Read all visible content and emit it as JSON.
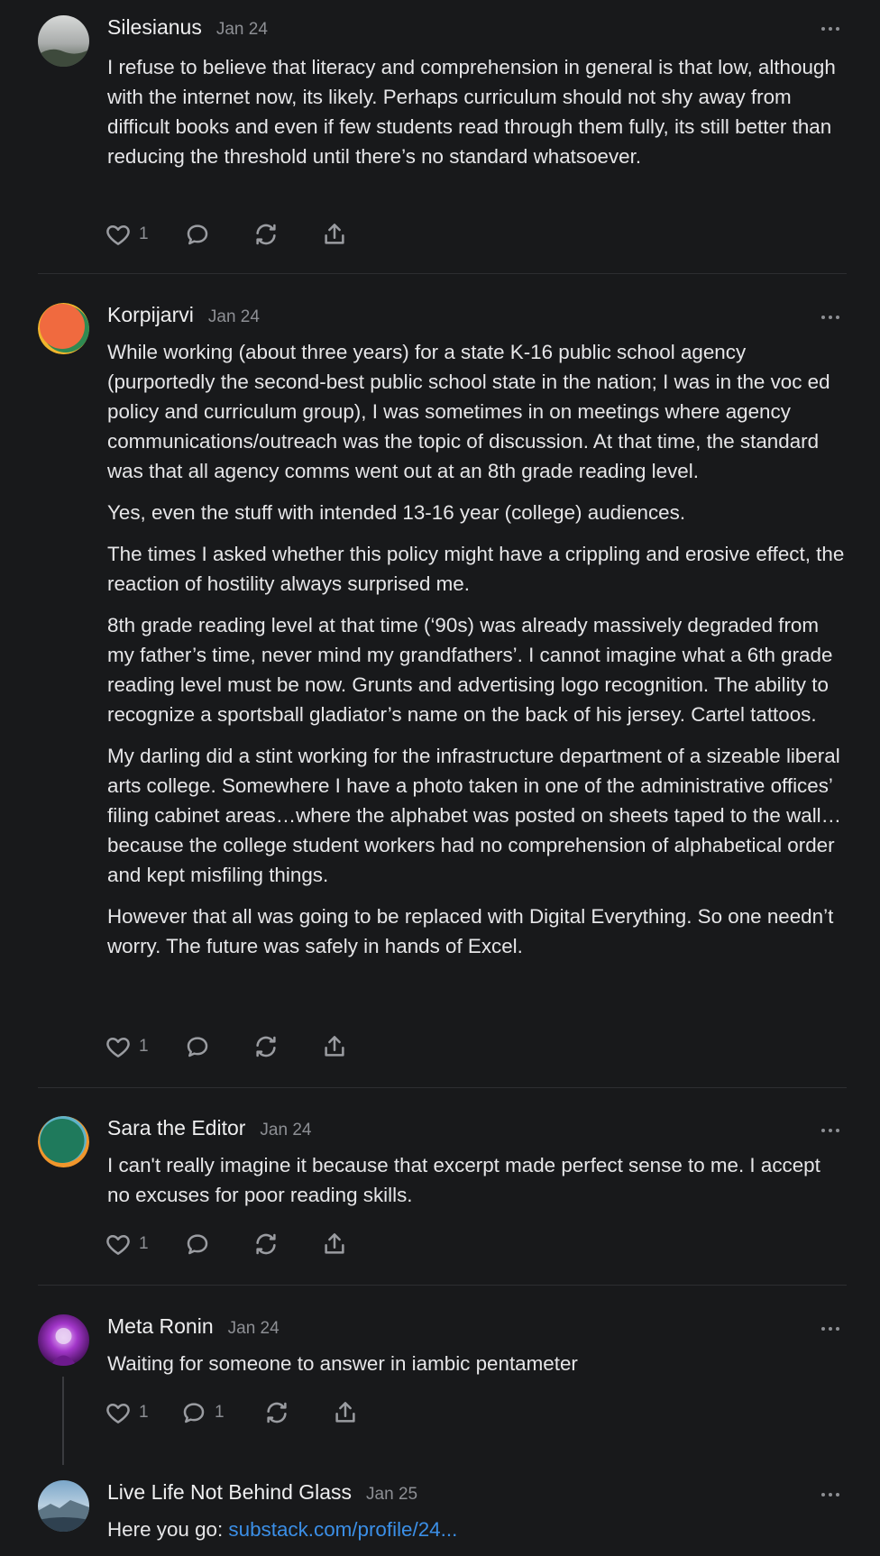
{
  "comments": [
    {
      "author": "Silesianus",
      "date": "Jan 24",
      "paragraphs": [
        "I refuse to believe that literacy and comprehension in general is that low, although with the internet now, its likely. Perhaps curriculum should not shy away from difficult books and even if few students read through them fully, its still better than reducing the threshold until there’s no standard whatsoever."
      ],
      "likes": "1"
    },
    {
      "author": "Korpijarvi",
      "date": "Jan 24",
      "paragraphs": [
        "While working (about three years) for a state K-16 public school agency (purportedly the second-best public school state in the nation; I was in the voc ed policy and curriculum group), I was sometimes in on meetings where agency communications/outreach was the topic of discussion. At that time, the standard was that all agency comms went out at an 8th grade reading level.",
        "Yes, even the stuff with intended 13-16 year (college) audiences.",
        "The times I asked whether this policy might have a crippling and erosive effect, the reaction of hostility always surprised me.",
        "8th grade reading level at that time (‘90s) was already massively degraded from my father’s time, never mind my grandfathers’. I cannot imagine what a 6th grade reading level must be now. Grunts and advertising logo recognition. The ability to recognize a sportsball gladiator’s name on the back of his jersey. Cartel tattoos.",
        "My darling did a stint working for the infrastructure department of a sizeable liberal arts college. Somewhere I have a photo taken in one of the administrative offices’ filing cabinet areas…where the alphabet was posted on sheets taped to the wall…because the college student workers had no comprehension of alphabetical order and kept misfiling things.",
        "However that all was going to be replaced with Digital Everything. So one needn’t worry. The future was safely in hands of Excel."
      ],
      "likes": "1"
    },
    {
      "author": "Sara the Editor",
      "date": "Jan 24",
      "paragraphs": [
        "I can't really imagine it because that excerpt made perfect sense to me. I accept no excuses for poor reading skills."
      ],
      "likes": "1"
    },
    {
      "author": "Meta Ronin",
      "date": "Jan 24",
      "paragraphs": [
        "Waiting for someone to answer in iambic pentameter"
      ],
      "likes": "1",
      "replies": "1"
    },
    {
      "author": "Live Life Not Behind Glass",
      "date": "Jan 25",
      "prefix": "Here you go: ",
      "link": "substack.com/profile/24..."
    }
  ],
  "icons": [
    "heart-icon",
    "comment-icon",
    "restack-icon",
    "share-icon",
    "more-icon"
  ],
  "colors": {
    "background": "#18191b",
    "text": "#e6e6e8",
    "muted": "#8d8f94",
    "link": "#3b8fe7"
  }
}
